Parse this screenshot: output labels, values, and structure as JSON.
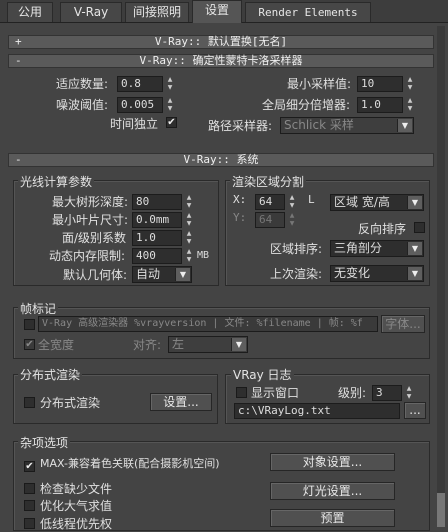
{
  "tabs": [
    {
      "label": "公用"
    },
    {
      "label": "V-Ray"
    },
    {
      "label": "间接照明"
    },
    {
      "label": "设置"
    },
    {
      "label": "Render Elements"
    }
  ],
  "rollouts": {
    "displacement": {
      "sign": "+",
      "title": "V-Ray:: 默认置换[无名]"
    },
    "sampler": {
      "sign": "-",
      "title": "V-Ray:: 确定性蒙特卡洛采样器"
    },
    "system": {
      "sign": "-",
      "title": "V-Ray:: 系统"
    }
  },
  "sampler": {
    "adaptive_amount": {
      "label": "适应数量:",
      "value": "0.8"
    },
    "noise_threshold": {
      "label": "噪波阈值:",
      "value": "0.005"
    },
    "time_independent": {
      "label": "时间独立",
      "checked": "✔"
    },
    "min_samples": {
      "label": "最小采样值:",
      "value": "10"
    },
    "global_subdivs": {
      "label": "全局细分倍增器:",
      "value": "1.0"
    },
    "path_sampler": {
      "label": "路径采样器:",
      "value": "Schlick 采样"
    }
  },
  "raycast": {
    "title": "光线计算参数",
    "max_tree_depth": {
      "label": "最大树形深度:",
      "value": "80"
    },
    "min_leaf_size": {
      "label": "最小叶片尺寸:",
      "value": "0.0mm"
    },
    "face_level_coef": {
      "label": "面/级别系数",
      "value": "1.0"
    },
    "dyn_mem_limit": {
      "label": "动态内存限制:",
      "value": "400",
      "unit": "MB"
    },
    "default_geometry": {
      "label": "默认几何体:",
      "value": "自动"
    }
  },
  "region": {
    "title": "渲染区域分割",
    "x": {
      "label": "X:",
      "value": "64"
    },
    "y": {
      "label": "Y:",
      "value": "64"
    },
    "lock": "L",
    "mode": {
      "value": "区域 宽/高"
    },
    "reverse": {
      "label": "反向排序"
    },
    "order": {
      "label": "区域排序:",
      "value": "三角剖分"
    },
    "last_render": {
      "label": "上次渲染:",
      "value": "无变化"
    }
  },
  "frame_stamp": {
    "title": "帧标记",
    "text": "V-Ray 高级渲染器 %vrayversion | 文件: %filename | 帧: %f",
    "font_button": "字体...",
    "full_width": {
      "label": "全宽度",
      "checked": "✔"
    },
    "justify": {
      "label": "对齐:",
      "value": "左"
    }
  },
  "distributed": {
    "title": "分布式渲染",
    "enable": {
      "label": "分布式渲染"
    },
    "settings_button": "设置..."
  },
  "log": {
    "title": "VRay 日志",
    "show_window": {
      "label": "显示窗口"
    },
    "level": {
      "label": "级别:",
      "value": "3"
    },
    "path": "c:\\VRayLog.txt",
    "browse": "..."
  },
  "misc": {
    "title": "杂项选项",
    "max_compat": {
      "label": "MAX-兼容着色关联(配合摄影机空间)",
      "checked": "✔"
    },
    "check_missing": {
      "label": "检查缺少文件"
    },
    "optimize_atmos": {
      "label": "优化大气求值"
    },
    "low_thread": {
      "label": "低线程优先权"
    },
    "object_settings": "对象设置...",
    "light_settings": "灯光设置...",
    "presets": "预置"
  }
}
